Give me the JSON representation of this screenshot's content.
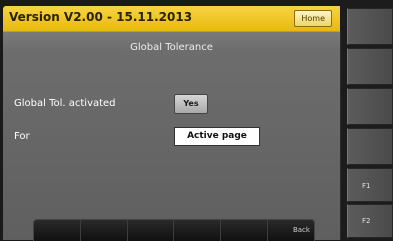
{
  "header": {
    "version": "Version V2.00 - 15.11.2013",
    "home_label": "Home"
  },
  "page": {
    "title": "Global Tolerance"
  },
  "settings": {
    "global_tol_label": "Global Tol. activated",
    "global_tol_value": "Yes",
    "for_label": "For",
    "for_value": "Active page"
  },
  "softkeys": [
    "",
    "",
    "",
    "",
    "",
    "Back"
  ],
  "side_keys": [
    "",
    "",
    "",
    "",
    "F1",
    "F2"
  ],
  "colors": {
    "header_yellow": "#f2c62a",
    "panel_gray": "#6d6d6d",
    "side_dark": "#1c1c1c"
  }
}
